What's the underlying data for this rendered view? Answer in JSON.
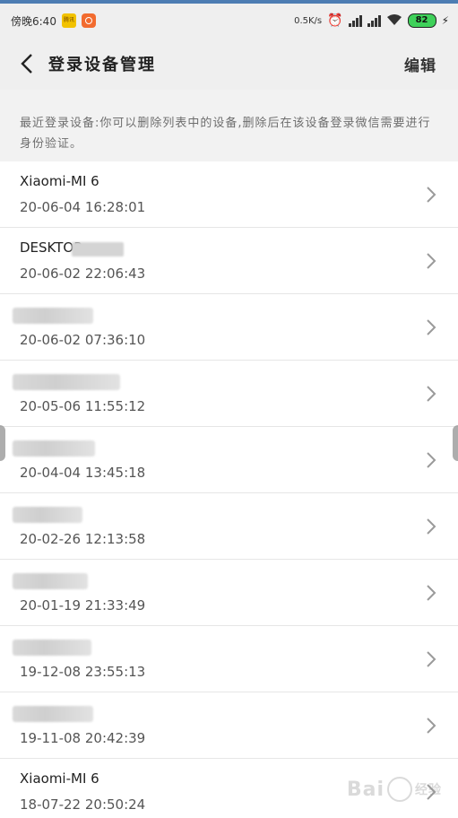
{
  "status_bar": {
    "time": "傍晚6:40",
    "app_badge_1": "腾讯",
    "net_speed": "0.5K/s",
    "battery": "82",
    "icons": [
      "alarm-icon",
      "hd-signal-icon",
      "signal-icon",
      "wifi-icon",
      "battery-icon",
      "charging-icon"
    ]
  },
  "header": {
    "title": "登录设备管理",
    "edit_label": "编辑",
    "back_icon": "chevron-left-icon"
  },
  "notice": {
    "text": "最近登录设备:你可以删除列表中的设备,删除后在该设备登录微信需要进行身份验证。"
  },
  "devices": [
    {
      "name": "Xiaomi-MI 6",
      "time": "20-06-04 16:28:01"
    },
    {
      "name": "DESKTOP-",
      "time": "20-06-02 22:06:43"
    },
    {
      "name": "",
      "time": "20-06-02 07:36:10"
    },
    {
      "name": "",
      "time": "20-05-06 11:55:12"
    },
    {
      "name": "",
      "time": "20-04-04 13:45:18"
    },
    {
      "name": "",
      "time": "20-02-26 12:13:58"
    },
    {
      "name": "",
      "time": "20-01-19 21:33:49"
    },
    {
      "name": "",
      "time": "19-12-08 23:55:13"
    },
    {
      "name": "",
      "time": "19-11-08 20:42:39"
    },
    {
      "name": "Xiaomi-MI 6",
      "time": "18-07-22 20:50:24"
    }
  ],
  "watermark": {
    "text": "Bai",
    "text2": "经验"
  },
  "colors": {
    "accent_top": "#4d7db3",
    "battery": "#3fd15a"
  }
}
